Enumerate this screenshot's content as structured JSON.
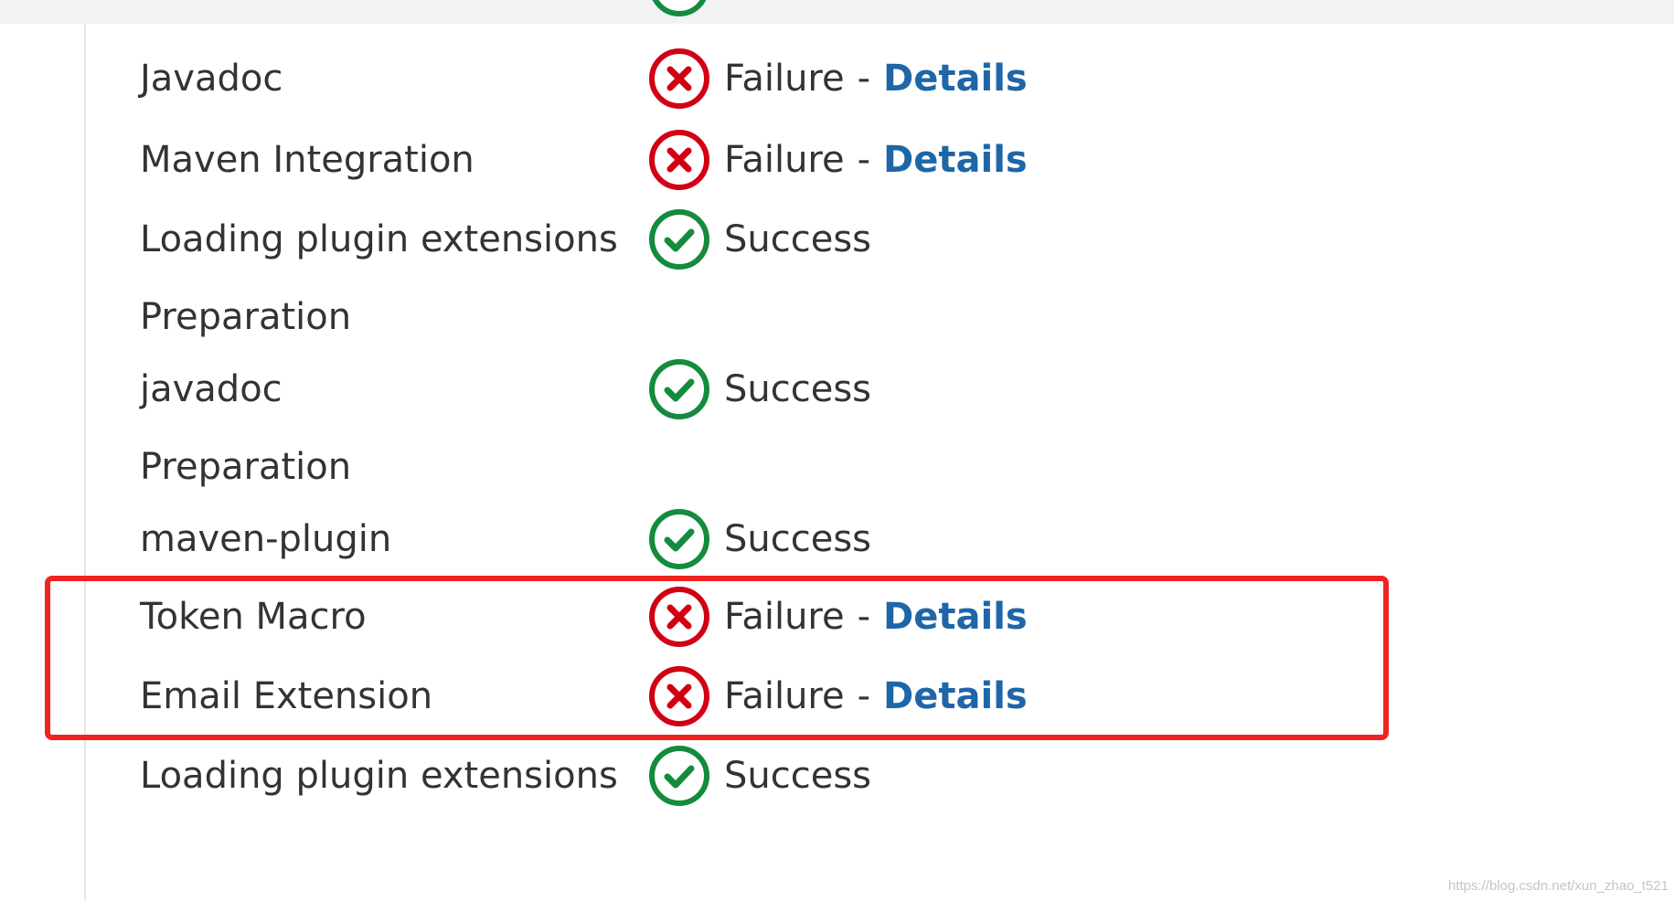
{
  "rows": [
    {
      "name": "Javadoc",
      "status": "failure",
      "status_text": "Failure",
      "separator": "-",
      "details_label": "Details"
    },
    {
      "name": "Maven Integration",
      "status": "failure",
      "status_text": "Failure",
      "separator": "-",
      "details_label": "Details"
    },
    {
      "name": "Loading plugin extensions",
      "status": "success",
      "status_text": "Success"
    },
    {
      "name": "Preparation",
      "status": "none"
    },
    {
      "name": "javadoc",
      "status": "success",
      "status_text": "Success"
    },
    {
      "name": "Preparation",
      "status": "none"
    },
    {
      "name": "maven-plugin",
      "status": "success",
      "status_text": "Success"
    },
    {
      "name": "Token Macro",
      "status": "failure",
      "status_text": "Failure",
      "separator": "-",
      "details_label": "Details"
    },
    {
      "name": "Email Extension",
      "status": "failure",
      "status_text": "Failure",
      "separator": "-",
      "details_label": "Details"
    },
    {
      "name": "Loading plugin extensions",
      "status": "success",
      "status_text": "Success"
    }
  ],
  "icons": {
    "failure": "failure-x-icon",
    "success": "success-check-icon"
  },
  "colors": {
    "failure": "#d10012",
    "success": "#148b3d",
    "link": "#1e66a8",
    "highlight": "#ef2320"
  },
  "watermark": "https://blog.csdn.net/xun_zhao_t521"
}
